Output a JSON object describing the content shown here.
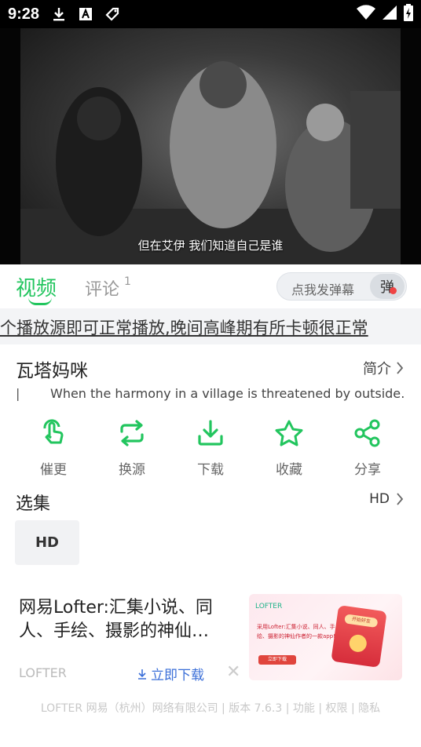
{
  "status_bar": {
    "time": "9:28"
  },
  "player": {
    "subtitle": "但在艾伊 我们知道自己是谁"
  },
  "tabs": {
    "video_label": "视频",
    "comments_label": "评论",
    "comments_count": "1"
  },
  "danmaku": {
    "placeholder": "点我发弹幕",
    "toggle_label": "弹"
  },
  "notice": {
    "text": "个播放源即可正常播放,晚间高峰期有所卡顿很正常"
  },
  "detail": {
    "title": "瓦塔妈咪",
    "intro_label": "简介",
    "description": "When the harmony in a village is threatened by outside…"
  },
  "actions": [
    {
      "label": "催更",
      "icon": "hand-pointer-icon"
    },
    {
      "label": "换源",
      "icon": "repeat-icon"
    },
    {
      "label": "下载",
      "icon": "download-icon"
    },
    {
      "label": "收藏",
      "icon": "star-icon"
    },
    {
      "label": "分享",
      "icon": "share-icon"
    }
  ],
  "episodes": {
    "title": "选集",
    "source_label": "HD",
    "items": [
      "HD"
    ]
  },
  "ad": {
    "title": "网易Lofter:汇集小说、同人、手绘、摄影的神仙…",
    "brand": "LOFTER",
    "download_label": "立即下载",
    "image_logo": "LOFTER",
    "image_text": "采用Lofter:汇集小说、同人、手绘、摄影的神仙作者的一款app!",
    "image_button": "立即下载",
    "image_badge": "开始好友"
  },
  "footer": {
    "text": "LOFTER 网易（杭州）网络有限公司 | 版本 7.6.3 | 功能 | 权限 | 隐私"
  },
  "colors": {
    "accent": "#22c55e",
    "link": "#3b6fd8"
  }
}
